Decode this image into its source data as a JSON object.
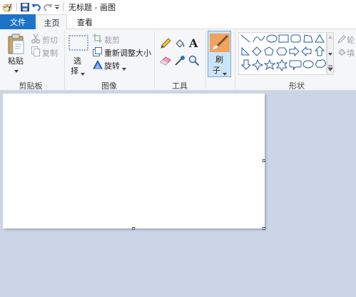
{
  "window": {
    "title": "无标题 - 画图"
  },
  "tabs": {
    "file": "文件",
    "home": "主页",
    "view": "查看"
  },
  "clipboard": {
    "paste": "粘贴",
    "cut": "剪切",
    "copy": "复制",
    "label": "剪贴板"
  },
  "image": {
    "select_1": "选",
    "select_2": "择",
    "crop": "裁剪",
    "resize": "重新调整大小",
    "rotate": "旋转",
    "label": "图像"
  },
  "tools": {
    "label": "工具"
  },
  "brush": {
    "label_1": "刷",
    "label_2": "子"
  },
  "shapes": {
    "label": "形状",
    "outline": "轮",
    "fill": "填"
  },
  "colors": {
    "accent": "#1e73c8",
    "ribbon_bg": "#f5f6f7",
    "workspace": "#ccd5e6"
  }
}
